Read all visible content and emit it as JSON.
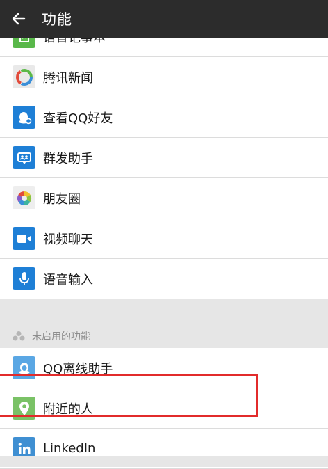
{
  "header": {
    "title": "功能"
  },
  "enabled_items": [
    {
      "label": "语音记事本",
      "icon": "notepad-icon"
    },
    {
      "label": "腾讯新闻",
      "icon": "tencent-news-icon"
    },
    {
      "label": "查看QQ好友",
      "icon": "qq-friends-icon"
    },
    {
      "label": "群发助手",
      "icon": "mass-message-icon"
    },
    {
      "label": "朋友圈",
      "icon": "moments-icon"
    },
    {
      "label": "视频聊天",
      "icon": "video-chat-icon"
    },
    {
      "label": "语音输入",
      "icon": "voice-input-icon"
    }
  ],
  "disabled_section": {
    "title": "未启用的功能",
    "items": [
      {
        "label": "QQ离线助手",
        "icon": "qq-offline-icon"
      },
      {
        "label": "附近的人",
        "icon": "location-pin-icon"
      },
      {
        "label": "LinkedIn",
        "icon": "linkedin-icon"
      }
    ]
  },
  "colors": {
    "header_bg": "#2c2c2c",
    "page_bg": "#e6e6e6",
    "highlight": "#e22b2b",
    "icon_blue": "#1e7fd6",
    "icon_green": "#59b84a",
    "nearby_green": "#7ac266",
    "offline_blue": "#5aa7e4",
    "linkedin_blue": "#3f8fd2"
  }
}
